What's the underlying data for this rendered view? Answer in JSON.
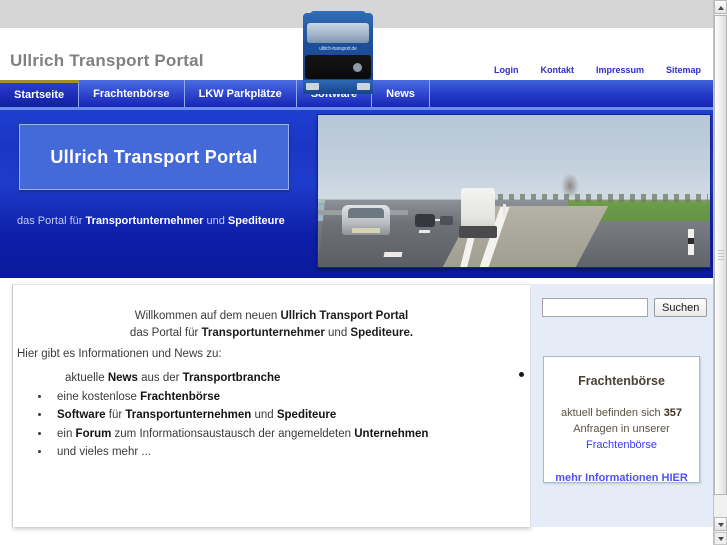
{
  "header": {
    "site_title": "Ullrich Transport Portal",
    "logo_caption": "ullrich-transport.de",
    "meta_nav": [
      {
        "label": "Login"
      },
      {
        "label": "Kontakt"
      },
      {
        "label": "Impressum"
      },
      {
        "label": "Sitemap"
      }
    ]
  },
  "nav": {
    "tabs": [
      {
        "label": "Startseite",
        "active": true
      },
      {
        "label": "Frachtenbörse",
        "active": false
      },
      {
        "label": "LKW Parkplätze",
        "active": false
      },
      {
        "label": "Software",
        "active": false
      },
      {
        "label": "News",
        "active": false
      }
    ]
  },
  "hero": {
    "box_title": "Ullrich Transport Portal",
    "subtitle_prefix": "das Portal für ",
    "subtitle_bold1": "Transportunternehmer",
    "subtitle_mid": " und ",
    "subtitle_bold2": "Spediteure",
    "photo_alt": "Autobahn mit PKW und LKW"
  },
  "main": {
    "welcome_line1_prefix": "Willkommen auf dem neuen ",
    "welcome_line1_bold": "Ullrich Transport Portal",
    "welcome_line2_prefix": "das Portal für ",
    "welcome_line2_bold1": "Transportunternehmer",
    "welcome_line2_mid": " und ",
    "welcome_line2_bold2": "Spediteure.",
    "intro": "Hier gibt es Informationen und News zu:",
    "list": [
      {
        "no_bullet": true,
        "parts": [
          {
            "text": "aktuelle ",
            "bold": false
          },
          {
            "text": "News",
            "bold": true
          },
          {
            "text": " aus der ",
            "bold": false
          },
          {
            "text": "Transportbranche",
            "bold": true
          }
        ]
      },
      {
        "no_bullet": false,
        "parts": [
          {
            "text": "eine kostenlose ",
            "bold": false
          },
          {
            "text": "Frachtenbörse",
            "bold": true
          }
        ]
      },
      {
        "no_bullet": false,
        "parts": [
          {
            "text": "Software",
            "bold": true
          },
          {
            "text": " für ",
            "bold": false
          },
          {
            "text": "Transportunternehmen",
            "bold": true
          },
          {
            "text": " und ",
            "bold": false
          },
          {
            "text": "Spediteure",
            "bold": true
          }
        ]
      },
      {
        "no_bullet": false,
        "parts": [
          {
            "text": "ein ",
            "bold": false
          },
          {
            "text": "Forum",
            "bold": true
          },
          {
            "text": " zum Informationsaustausch der angemeldeten ",
            "bold": false
          },
          {
            "text": "Unternehmen",
            "bold": true
          }
        ]
      },
      {
        "no_bullet": false,
        "parts": [
          {
            "text": "und vieles mehr ...",
            "bold": false
          }
        ]
      }
    ]
  },
  "sidebar": {
    "search": {
      "value": "",
      "placeholder": "",
      "button_label": "Suchen"
    },
    "box": {
      "title": "Frachtenbörse",
      "line1_prefix": "aktuell befinden sich ",
      "count": "357",
      "line2": "Anfragen in unserer",
      "link": "Frachtenbörse",
      "more_link": "mehr Informationen HIER"
    }
  },
  "colors": {
    "accent_blue": "#1426b4",
    "hero_box": "#4469d9",
    "link_blue": "#3a3af0",
    "active_tab_top": "#a98b2e",
    "sidebar_bg": "#e6ecf7",
    "top_band": "#d6d6d6"
  }
}
